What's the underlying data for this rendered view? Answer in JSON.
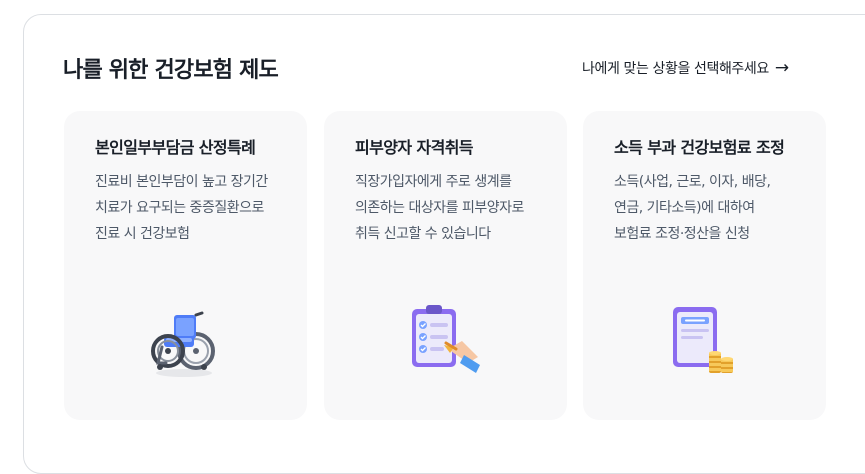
{
  "section": {
    "title": "나를 위한 건강보험 제도",
    "more_link_label": "나에게 맞는 상황을 선택해주세요",
    "more_link_arrow": "→"
  },
  "cards": [
    {
      "title": "본인일부부담금 산정특례",
      "description": "진료비 본인부담이 높고 장기간 치료가 요구되는 중증질환으로 진료 시 건강보험",
      "icon": "wheelchair-icon"
    },
    {
      "title": "피부양자 자격취득",
      "description": "직장가입자에게 주로 생계를 의존하는 대상자를 피부양자로 취득 신고할 수 있습니다",
      "icon": "clipboard-checklist-icon"
    },
    {
      "title": "소득 부과 건강보험료 조정",
      "description": "소득(사업, 근로, 이자, 배당, 연금, 기타소득)에 대하여 보험료 조정·정산을 신청",
      "icon": "insurance-document-coins-icon"
    }
  ],
  "colors": {
    "card_background": "#f8f8f9",
    "title_text": "#191f28",
    "body_text": "#4e5968",
    "accent_blue": "#4f7cf7",
    "accent_purple": "#8b6cf0",
    "coin_gold": "#f2b33d"
  }
}
